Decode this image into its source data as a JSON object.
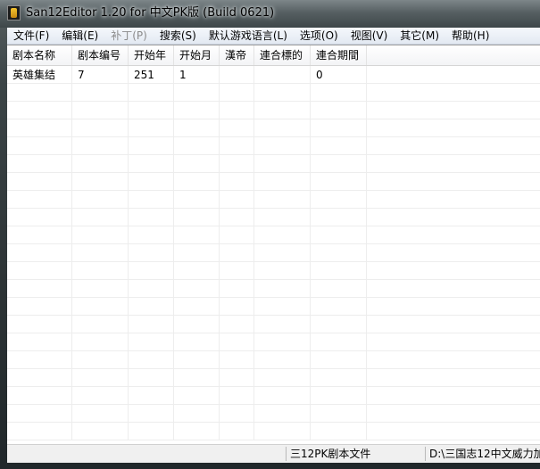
{
  "window": {
    "title": "San12Editor 1.20 for 中文PK版 (Build 0621)",
    "icon": "app-icon"
  },
  "menu": [
    {
      "label": "文件(F)",
      "enabled": true
    },
    {
      "label": "编辑(E)",
      "enabled": true
    },
    {
      "label": "补丁(P)",
      "enabled": false
    },
    {
      "label": "搜索(S)",
      "enabled": true
    },
    {
      "label": "默认游戏语言(L)",
      "enabled": true
    },
    {
      "label": "选项(O)",
      "enabled": true
    },
    {
      "label": "视图(V)",
      "enabled": true
    },
    {
      "label": "其它(M)",
      "enabled": true
    },
    {
      "label": "帮助(H)",
      "enabled": true
    }
  ],
  "table": {
    "columns": [
      "剧本名称",
      "剧本编号",
      "开始年",
      "开始月",
      "漢帝",
      "連合標的",
      "連合期間"
    ],
    "rows": [
      [
        "英雄集结",
        "7",
        "251",
        "1",
        "",
        "",
        "0"
      ]
    ]
  },
  "statusbar": {
    "panes": [
      "",
      "三12PK剧本文件",
      "D:\\三国志12中文威力加"
    ]
  },
  "colors": {
    "frame": "#3b4446",
    "menubar": "#e3e9f2",
    "gridline": "#ededed"
  }
}
